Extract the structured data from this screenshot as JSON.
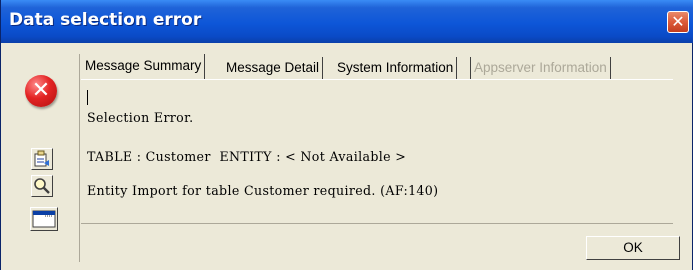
{
  "window": {
    "title": "Data selection error",
    "close_glyph": "✕"
  },
  "error_icon": {
    "glyph": "✕",
    "color": "#e32424"
  },
  "tabs": [
    {
      "label": "Message Summary",
      "state": "active"
    },
    {
      "label": "Message Detail",
      "state": "normal"
    },
    {
      "label": "System Information",
      "state": "normal"
    },
    {
      "label": "Appserver Information",
      "state": "disabled"
    }
  ],
  "message": {
    "lines": [
      "Selection Error.",
      "TABLE : Customer  ENTITY : < Not Available >",
      "Entity Import for table Customer required. (AF:140)"
    ]
  },
  "side_buttons": [
    {
      "icon": "copy-clipboard-icon"
    },
    {
      "icon": "magnifier-icon"
    },
    {
      "icon": "window-icon"
    }
  ],
  "buttons": {
    "ok_label": "OK"
  },
  "colors": {
    "titlebar": "#0d56d8",
    "window_bg": "#ece9d8",
    "disabled_text": "#aca899"
  }
}
